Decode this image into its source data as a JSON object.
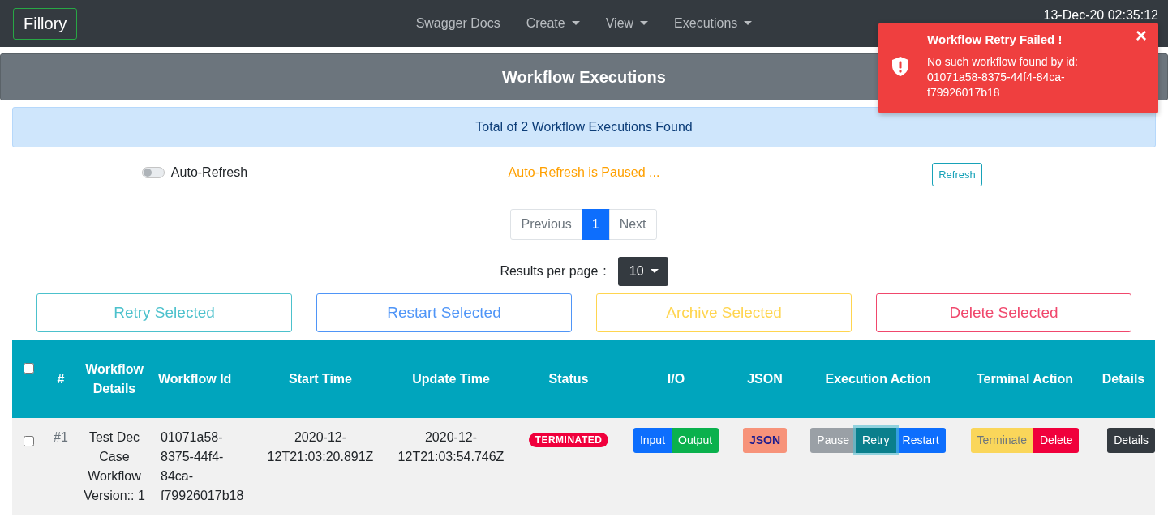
{
  "navbar": {
    "brand": "Fillory",
    "links": [
      {
        "label": "Swagger Docs",
        "dropdown": false
      },
      {
        "label": "Create",
        "dropdown": true
      },
      {
        "label": "View",
        "dropdown": true
      },
      {
        "label": "Executions",
        "dropdown": true
      }
    ],
    "timestamp": "13-Dec-20 02:35:12"
  },
  "toast": {
    "title": "Workflow Retry Failed !",
    "message": "No such workflow found by id: 01071a58-8375-44f4-84ca-f79926017b18",
    "close": "×"
  },
  "page_title": "Workflow Executions",
  "summary": "Total of 2 Workflow Executions Found",
  "auto_refresh": {
    "label": "Auto-Refresh",
    "on": false,
    "status": "Auto-Refresh is Paused ...",
    "refresh_button": "Refresh"
  },
  "pagination": [
    {
      "label": "Previous",
      "selected": false
    },
    {
      "label": "1",
      "selected": true
    },
    {
      "label": "Next",
      "selected": false
    }
  ],
  "results_per_page": {
    "label": "Results per page",
    "separator": ":",
    "value": "10"
  },
  "bulk_actions": [
    {
      "label": "Retry Selected",
      "kind": "info"
    },
    {
      "label": "Restart Selected",
      "kind": "primary"
    },
    {
      "label": "Archive Selected",
      "kind": "warning"
    },
    {
      "label": "Delete Selected",
      "kind": "danger"
    }
  ],
  "table": {
    "select_all": {
      "checked": false
    },
    "columns": [
      "#",
      "Workflow Details",
      "Workflow Id",
      "Start Time",
      "Update Time",
      "Status",
      "I/O",
      "JSON",
      "Execution Action",
      "Terminal Action",
      "Details"
    ],
    "rows": [
      {
        "selected": false,
        "number": "#1",
        "details": "Test Dec Case Workflow Version:: 1",
        "id": "01071a58-8375-44f4-84ca-f79926017b18",
        "start": "2020-12-12T21:03:20.891Z",
        "update": "2020-12-12T21:03:54.746Z",
        "status": "TERMINATED",
        "groups": [
          [
            {
              "label": "Input",
              "kind": "primary",
              "focused": false
            },
            {
              "label": "Output",
              "kind": "success",
              "focused": false
            }
          ],
          [
            {
              "label": "JSON",
              "kind": "json",
              "focused": false
            }
          ],
          [
            {
              "label": "Pause",
              "kind": "secondary",
              "focused": false
            },
            {
              "label": "Retry",
              "kind": "teal",
              "focused": true
            },
            {
              "label": "Restart",
              "kind": "primary",
              "focused": false
            }
          ],
          [
            {
              "label": "Terminate",
              "kind": "warning",
              "focused": false
            },
            {
              "label": "Delete",
              "kind": "danger",
              "focused": false
            }
          ],
          [
            {
              "label": "Details",
              "kind": "dark",
              "focused": false
            }
          ]
        ]
      }
    ]
  }
}
